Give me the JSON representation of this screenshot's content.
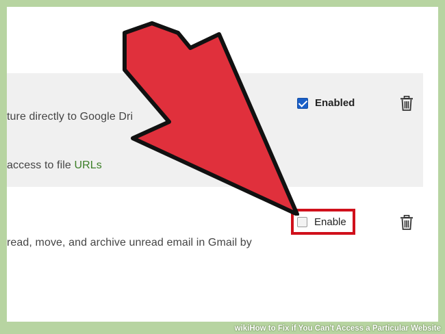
{
  "extensions": [
    {
      "description_line": "ture directly to Google Dri",
      "option_prefix": "access to file ",
      "option_link": "URLs",
      "checkbox_label": "Enabled",
      "checked": true,
      "trash_icon": "trash-icon"
    },
    {
      "description_line": "read, move, and archive unread email in Gmail by",
      "checkbox_label": "Enable",
      "checked": false,
      "trash_icon": "trash-icon"
    }
  ],
  "overlay": {
    "arrow_color": "#e0303c",
    "highlight_color": "#d0101b"
  },
  "banner": {
    "brand": "wiki",
    "title": "How to Fix if You Can't Access a Particular Website"
  },
  "colors": {
    "frame": "#b7d4a1",
    "row_highlight": "#f0f0f0",
    "checkbox_checked": "#1a5fc7",
    "link": "#3a7d25"
  }
}
